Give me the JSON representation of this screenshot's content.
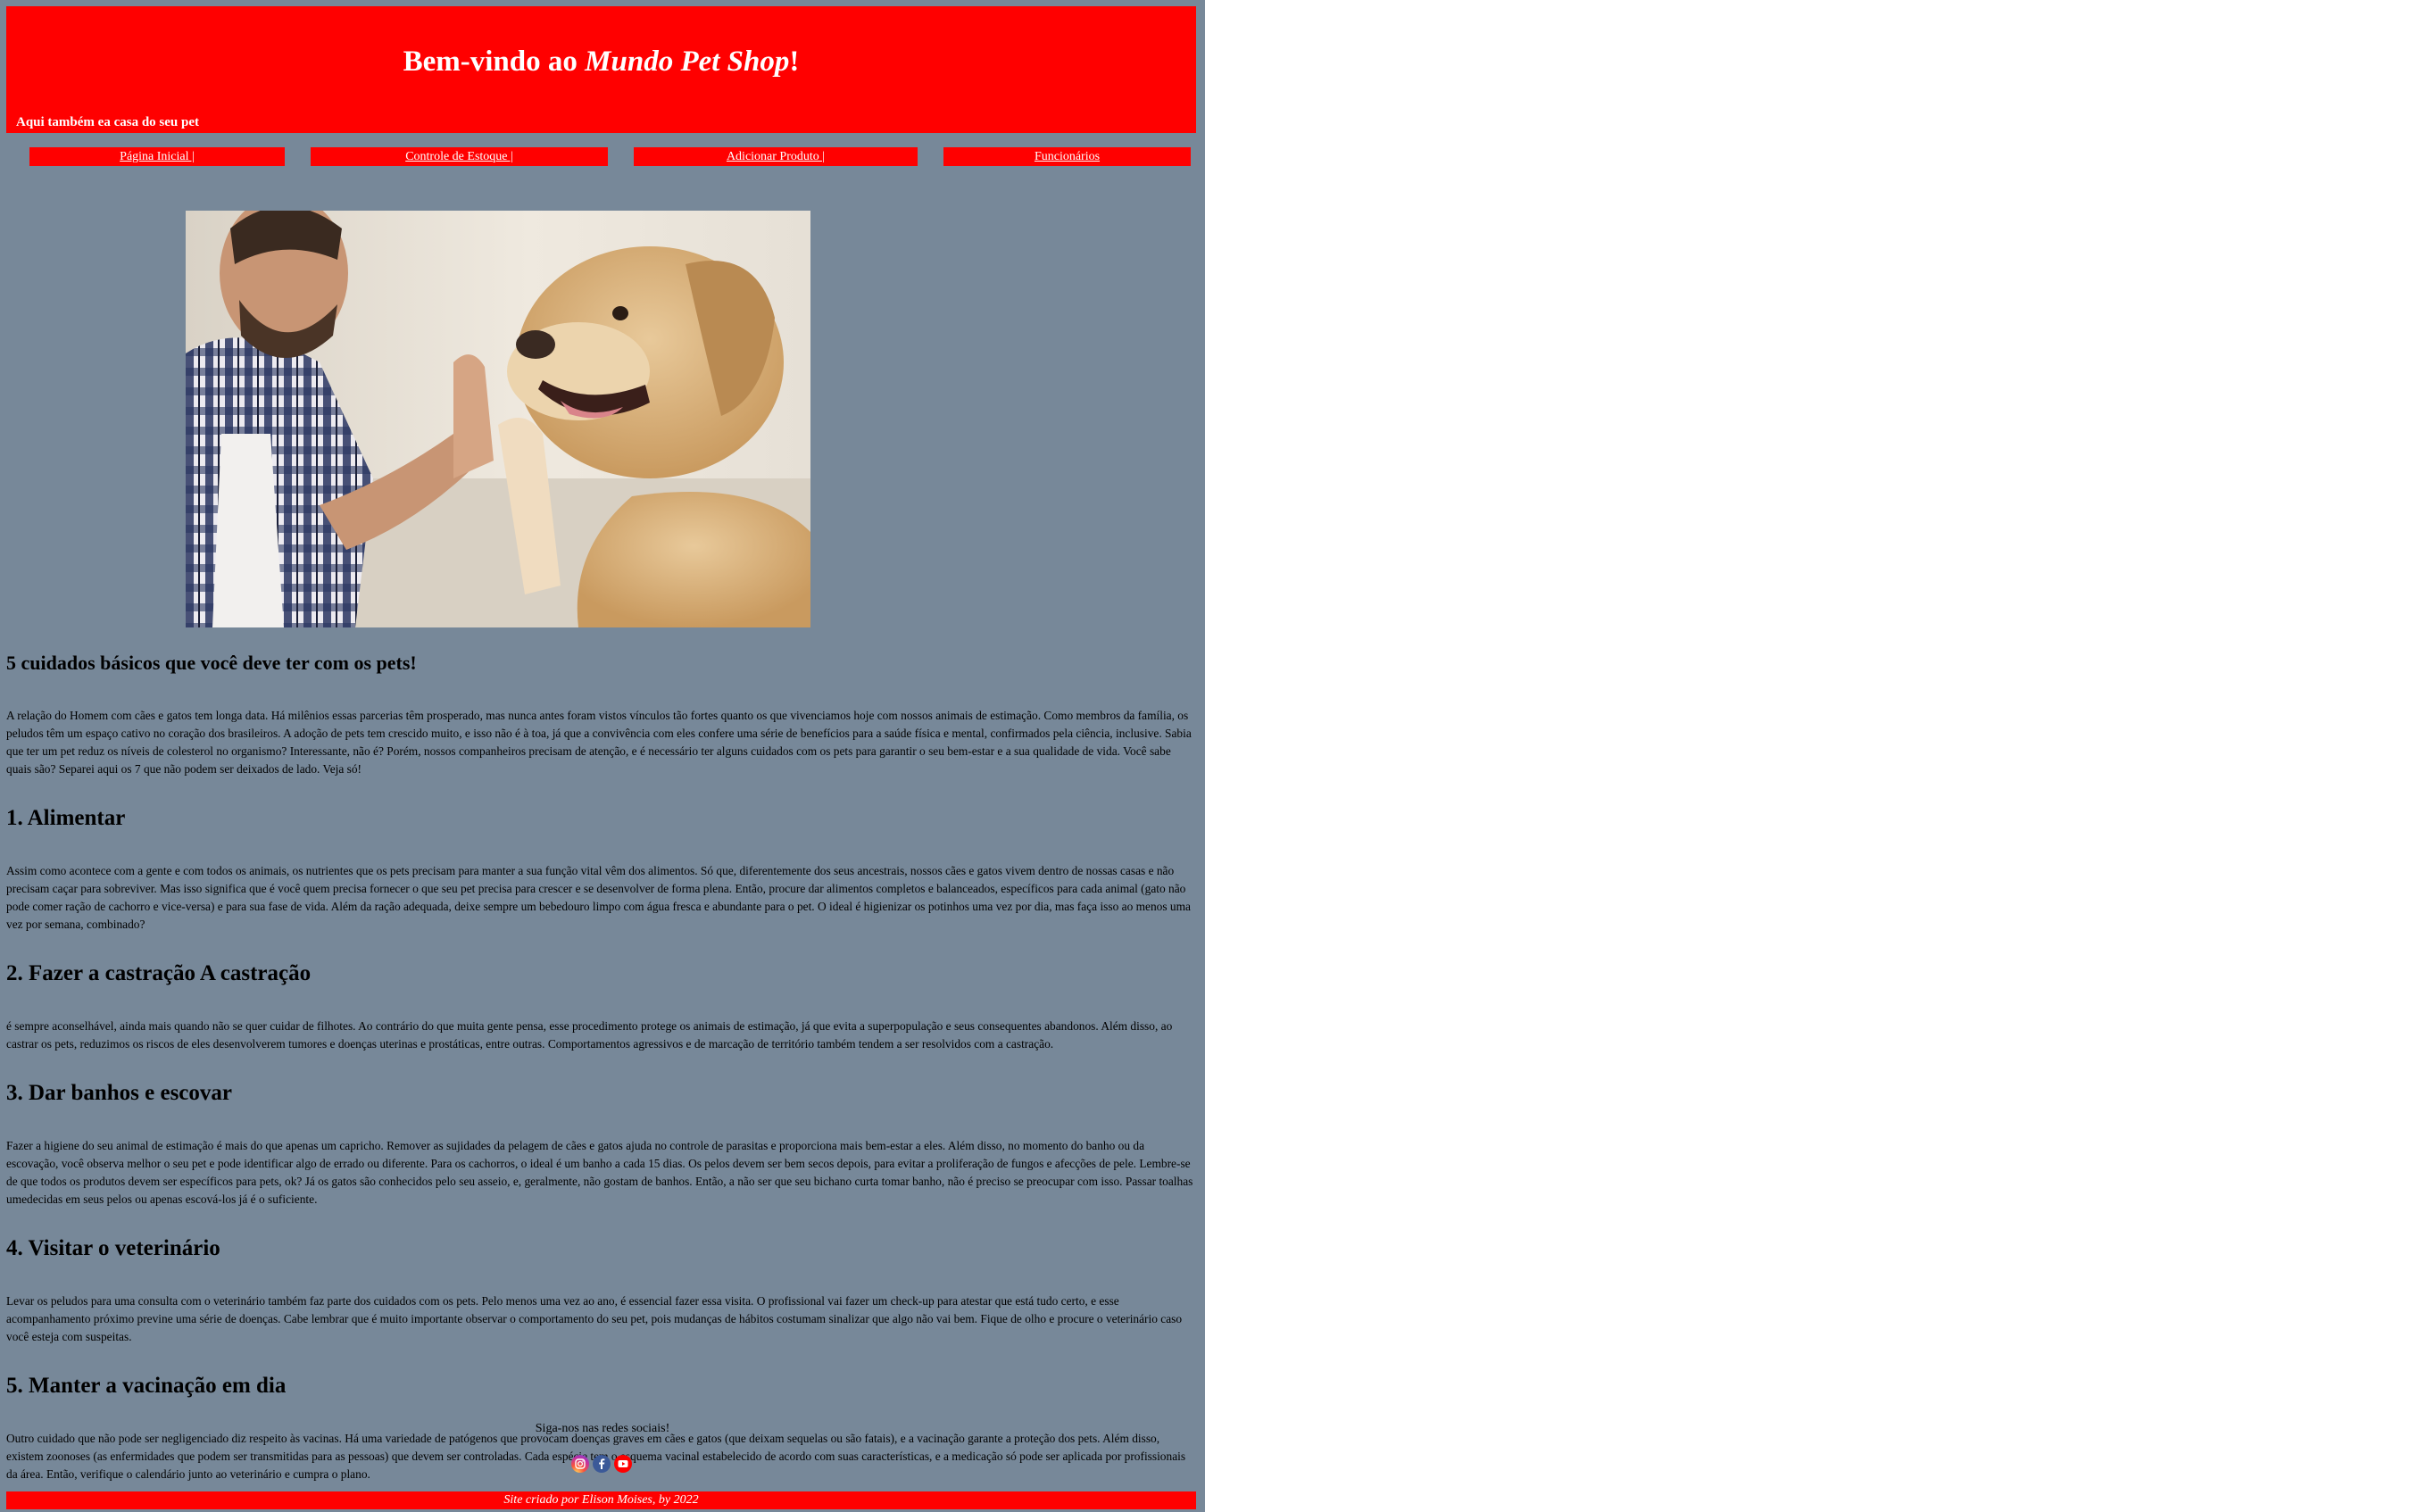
{
  "header": {
    "title_prefix": "Bem-vindo ao ",
    "title_brand": "Mundo Pet Shop",
    "title_suffix": "!",
    "tagline": "Aqui também ea casa do seu pet"
  },
  "nav": [
    {
      "label": "Página Inicial |"
    },
    {
      "label": "Controle de Estoque |"
    },
    {
      "label": "Adicionar Produto |"
    },
    {
      "label": "Funcionários"
    }
  ],
  "article": {
    "title": "5 cuidados básicos que você deve ter com os pets!",
    "intro": "A relação do Homem com cães e gatos tem longa data. Há milênios essas parcerias têm prosperado, mas nunca antes foram vistos vínculos tão fortes quanto os que vivenciamos hoje com nossos animais de estimação. Como membros da família, os peludos têm um espaço cativo no coração dos brasileiros. A adoção de pets tem crescido muito, e isso não é à toa, já que a convivência com eles confere uma série de benefícios para a saúde física e mental, confirmados pela ciência, inclusive. Sabia que ter um pet reduz os níveis de colesterol no organismo? Interessante, não é? Porém, nossos companheiros precisam de atenção, e é necessário ter alguns cuidados com os pets para garantir o seu bem-estar e a sua qualidade de vida. Você sabe quais são? Separei aqui os 7 que não podem ser deixados de lado. Veja só!",
    "sections": [
      {
        "heading": "1. Alimentar",
        "text": "Assim como acontece com a gente e com todos os animais, os nutrientes que os pets precisam para manter a sua função vital vêm dos alimentos. Só que, diferentemente dos seus ancestrais, nossos cães e gatos vivem dentro de nossas casas e não precisam caçar para sobreviver. Mas isso significa que é você quem precisa fornecer o que seu pet precisa para crescer e se desenvolver de forma plena. Então, procure dar alimentos completos e balanceados, específicos para cada animal (gato não pode comer ração de cachorro e vice-versa) e para sua fase de vida. Além da ração adequada, deixe sempre um bebedouro limpo com água fresca e abundante para o pet. O ideal é higienizar os potinhos uma vez por dia, mas faça isso ao menos uma vez por semana, combinado?"
      },
      {
        "heading": "2. Fazer a castração A castração",
        "text": "é sempre aconselhável, ainda mais quando não se quer cuidar de filhotes. Ao contrário do que muita gente pensa, esse procedimento protege os animais de estimação, já que evita a superpopulação e seus consequentes abandonos. Além disso, ao castrar os pets, reduzimos os riscos de eles desenvolverem tumores e doenças uterinas e prostáticas, entre outras. Comportamentos agressivos e de marcação de território também tendem a ser resolvidos com a castração."
      },
      {
        "heading": "3. Dar banhos e escovar",
        "text": "Fazer a higiene do seu animal de estimação é mais do que apenas um capricho. Remover as sujidades da pelagem de cães e gatos ajuda no controle de parasitas e proporciona mais bem-estar a eles. Além disso, no momento do banho ou da escovação, você observa melhor o seu pet e pode identificar algo de errado ou diferente. Para os cachorros, o ideal é um banho a cada 15 dias. Os pelos devem ser bem secos depois, para evitar a proliferação de fungos e afecções de pele. Lembre-se de que todos os produtos devem ser específicos para pets, ok? Já os gatos são conhecidos pelo seu asseio, e, geralmente, não gostam de banhos. Então, a não ser que seu bichano curta tomar banho, não é preciso se preocupar com isso. Passar toalhas umedecidas em seus pelos ou apenas escová-los já é o suficiente."
      },
      {
        "heading": "4. Visitar o veterinário",
        "text": "Levar os peludos para uma consulta com o veterinário também faz parte dos cuidados com os pets. Pelo menos uma vez ao ano, é essencial fazer essa visita. O profissional vai fazer um check-up para atestar que está tudo certo, e esse acompanhamento próximo previne uma série de doenças. Cabe lembrar que é muito importante observar o comportamento do seu pet, pois mudanças de hábitos costumam sinalizar que algo não vai bem. Fique de olho e procure o veterinário caso você esteja com suspeitas."
      },
      {
        "heading": "5. Manter a vacinação em dia",
        "text": "Outro cuidado que não pode ser negligenciado diz respeito às vacinas. Há uma variedade de patógenos que provocam doenças graves em cães e gatos (que deixam sequelas ou são fatais), e a vacinação garante a proteção dos pets. Além disso, existem zoonoses (as enfermidades que podem ser transmitidas para as pessoas) que devem ser controladas. Cada espécie tem o esquema vacinal estabelecido de acordo com suas características, e a medicação só pode ser aplicada por profissionais da área. Então, verifique o calendário junto ao veterinário e cumpra o plano."
      }
    ]
  },
  "social": {
    "label": "Siga-nos nas redes sociais!",
    "icons": [
      "instagram-icon",
      "facebook-icon",
      "youtube-icon"
    ]
  },
  "footer": {
    "text": "Site criado por Elison Moises, by 2022"
  },
  "colors": {
    "accent": "#ff0000",
    "background": "#778899",
    "text_light": "#ffffff"
  }
}
